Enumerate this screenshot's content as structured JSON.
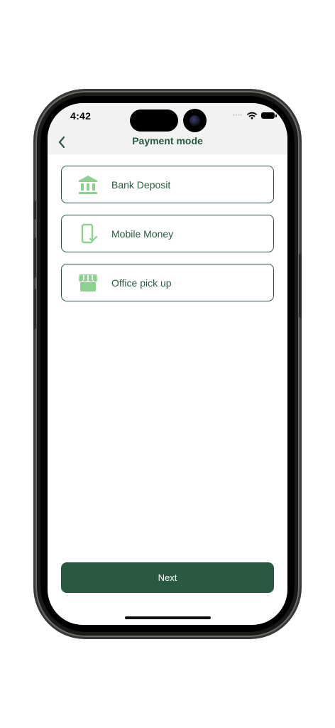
{
  "status_bar": {
    "time": "4:42",
    "signal_icon": "signal-dots-icon",
    "wifi_icon": "wifi-icon",
    "battery_icon": "battery-icon"
  },
  "header": {
    "title": "Payment mode",
    "back_icon": "chevron-left-icon"
  },
  "options": [
    {
      "label": "Bank Deposit",
      "icon": "bank-icon"
    },
    {
      "label": "Mobile Money",
      "icon": "mobile-check-icon"
    },
    {
      "label": "Office pick up",
      "icon": "storefront-icon"
    }
  ],
  "footer": {
    "next_label": "Next"
  },
  "colors": {
    "primary": "#2a5941",
    "icon_accent": "#8dd08f",
    "header_bg": "#f2f2f2"
  }
}
